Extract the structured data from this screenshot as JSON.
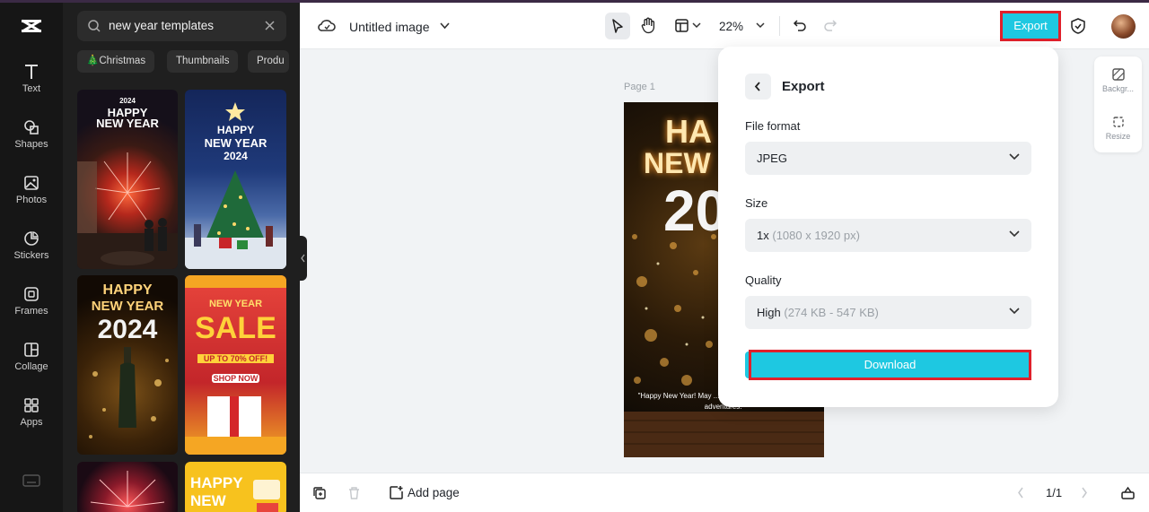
{
  "colors": {
    "accent": "#1ec8e1",
    "highlight": "#e0202b",
    "rail": "#161616",
    "panel": "#1f1f1f"
  },
  "sidebar": {
    "items": [
      {
        "label": "Text",
        "icon": "text-icon"
      },
      {
        "label": "Shapes",
        "icon": "shapes-icon"
      },
      {
        "label": "Photos",
        "icon": "photos-icon"
      },
      {
        "label": "Stickers",
        "icon": "stickers-icon"
      },
      {
        "label": "Frames",
        "icon": "frames-icon"
      },
      {
        "label": "Collage",
        "icon": "collage-icon"
      },
      {
        "label": "Apps",
        "icon": "apps-icon"
      }
    ]
  },
  "search": {
    "value": "new year templates"
  },
  "chips": [
    "🎄Christmas",
    "Thumbnails",
    "Produ"
  ],
  "templates": {
    "t1": {
      "line1": "2024",
      "line2": "HAPPY",
      "line3": "NEW YEAR"
    },
    "t2": {
      "line1": "HAPPY",
      "line2": "NEW YEAR",
      "line3": "2024"
    },
    "t3": {
      "line1": "HAPPY",
      "line2": "NEW YEAR",
      "line3": "2024"
    },
    "t4": {
      "line1": "NEW YEAR",
      "line2": "SALE",
      "line3": "UP TO 70% OFF!",
      "line4": "SHOP NOW"
    },
    "t6": {
      "line1": "HAPPY",
      "line2": "NEW"
    }
  },
  "toolbar": {
    "title": "Untitled image",
    "zoom": "22%",
    "export_label": "Export"
  },
  "canvas": {
    "page_label": "Page 1",
    "design": {
      "line1": "HA",
      "line2": "NEW",
      "line3": "20",
      "quote": "\"Happy New Year! May ... with joy, prosperity, and new adventures.\""
    }
  },
  "right_tools": {
    "background_label": "Backgr...",
    "resize_label": "Resize"
  },
  "export": {
    "title": "Export",
    "file_format": {
      "label": "File format",
      "value": "JPEG"
    },
    "size": {
      "label": "Size",
      "value": "1x",
      "detail": "(1080 x 1920 px)"
    },
    "quality": {
      "label": "Quality",
      "value": "High",
      "detail": "(274 KB - 547 KB)"
    },
    "download_label": "Download"
  },
  "bottom": {
    "add_page_label": "Add page",
    "page_count": "1/1"
  }
}
